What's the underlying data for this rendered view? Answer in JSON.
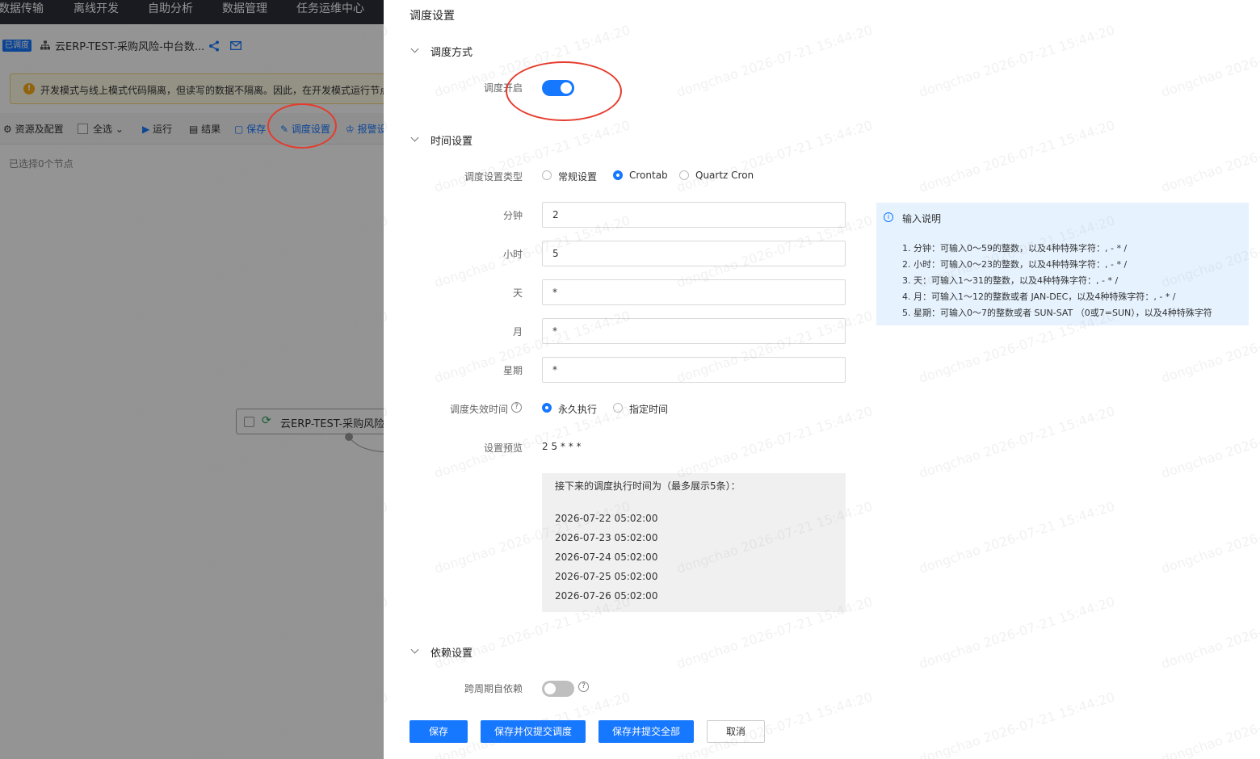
{
  "background": {
    "topnav": [
      "数据传输",
      "离线开发",
      "自助分析",
      "数据管理",
      "任务运维中心"
    ],
    "tab_badge": "已调度",
    "tab_title": "云ERP-TEST-采购风险-中台数...",
    "warning": "开发模式与线上模式代码隔离，但读写的数据不隔离。因此，在开发模式运行节点",
    "toolbar": {
      "resource": "资源及配置",
      "select_all": "全选",
      "run": "运行",
      "result": "结果",
      "save": "保存",
      "schedule": "调度设置",
      "alarm": "报警设"
    },
    "selected_count": "已选择0个节点",
    "node_label": "云ERP-TEST-采购风险-"
  },
  "drawer": {
    "title": "调度设置",
    "section_mode": "调度方式",
    "schedule_enable_label": "调度开启",
    "schedule_enabled": true,
    "section_time": "时间设置",
    "type_label": "调度设置类型",
    "type_options": [
      "常规设置",
      "Crontab",
      "Quartz Cron"
    ],
    "type_selected": "Crontab",
    "minute_label": "分钟",
    "minute_value": "2",
    "hour_label": "小时",
    "hour_value": "5",
    "day_label": "天",
    "day_value": "*",
    "month_label": "月",
    "month_value": "*",
    "week_label": "星期",
    "week_value": "*",
    "expire_label": "调度失效时间",
    "expire_options": [
      "永久执行",
      "指定时间"
    ],
    "expire_selected": "永久执行",
    "preview_label": "设置预览",
    "preview_value": "2 5 * * *",
    "next_runs_header": "接下来的调度执行时间为（最多展示5条）：",
    "next_runs": [
      "2026-07-22 05:02:00",
      "2026-07-23 05:02:00",
      "2026-07-24 05:02:00",
      "2026-07-25 05:02:00",
      "2026-07-26 05:02:00"
    ],
    "info_title": "输入说明",
    "info_lines": [
      "1. 分钟：可输入0～59的整数，以及4种特殊字符：, - * /",
      "2. 小时：可输入0～23的整数，以及4种特殊字符：, - * /",
      "3. 天：可输入1～31的整数，以及4种特殊字符：, - * /",
      "4. 月：可输入1～12的整数或者 JAN-DEC，以及4种特殊字符：, - * /",
      "5. 星期：可输入0～7的整数或者 SUN-SAT （0或7=SUN），以及4种特殊字符"
    ],
    "section_dep": "依赖设置",
    "self_dep_label": "跨周期自依赖",
    "self_dep_enabled": false,
    "buttons": {
      "save": "保存",
      "save_submit": "保存并仅提交调度",
      "save_submit_all": "保存并提交全部",
      "cancel": "取消"
    }
  },
  "watermark": "dongchao 2026-07-21 15:44:20",
  "colors": {
    "primary": "#1677ff",
    "annotation": "#e53b2c",
    "nav_bg": "#2b2f3a",
    "info_bg": "#e6f3ff"
  }
}
